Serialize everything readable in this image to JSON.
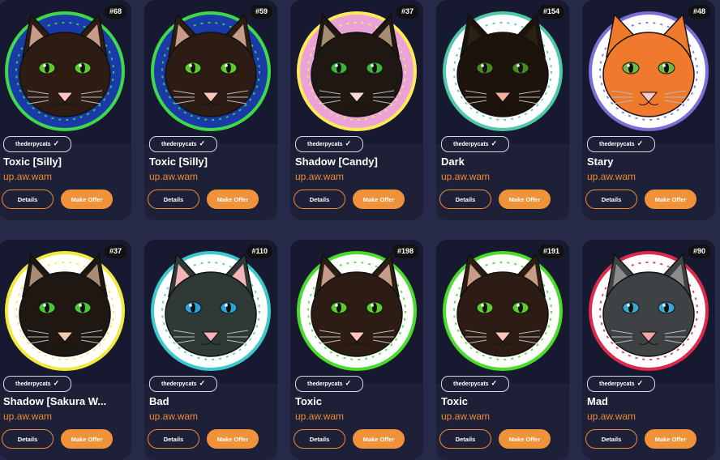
{
  "cards": [
    {
      "id": "#68",
      "creator": "thederpycats",
      "title": "Toxic [Silly]",
      "owner": "up.aw.wam",
      "details": "Details",
      "offer": "Make Offer",
      "ring": "#1a3aa8",
      "ring2": "#3fd84a",
      "face": "#2c1c14",
      "ear": "#c79c86",
      "eye": "#5ecb2a",
      "nose": "#ffc4b8",
      "frame": "#1a1c35"
    },
    {
      "id": "#59",
      "creator": "thederpycats",
      "title": "Toxic [Silly]",
      "owner": "up.aw.wam",
      "details": "Details",
      "offer": "Make Offer",
      "ring": "#1a3aa8",
      "ring2": "#3fd84a",
      "face": "#2c1c14",
      "ear": "#c79c86",
      "eye": "#5ecb2a",
      "nose": "#ffc4b8",
      "frame": "#1a1c35"
    },
    {
      "id": "#37",
      "creator": "thederpycats",
      "title": "Shadow [Candy]",
      "owner": "up.aw.wam",
      "details": "Details",
      "offer": "Make Offer",
      "ring": "#e9a3d6",
      "ring2": "#ffe95a",
      "face": "#1f1712",
      "ear": "#a88c70",
      "eye": "#3cb437",
      "nose": "#ffd8d0",
      "frame": "#1a1c35"
    },
    {
      "id": "#154",
      "creator": "thederpycats",
      "title": "Dark",
      "owner": "up.aw.wam",
      "details": "Details",
      "offer": "Make Offer",
      "ring": "#ffffff",
      "ring2": "#4ec8a6",
      "face": "#1c130d",
      "ear": "#2b2015",
      "eye": "#4a8a22",
      "nose": "#f5b09a",
      "frame": "#1a1c35"
    },
    {
      "id": "#48",
      "creator": "thederpycats",
      "title": "Stary",
      "owner": "up.aw.wam",
      "details": "Details",
      "offer": "Make Offer",
      "ring": "#ffffff",
      "ring2": "#7a6ed8",
      "face": "#ef7a2e",
      "ear": "#ef7a2e",
      "eye": "#6fb84a",
      "nose": "#ffc7c7",
      "frame": "#1a1c35"
    },
    {
      "id": "#37",
      "creator": "thederpycats",
      "title": "Shadow [Sakura W...",
      "owner": "up.aw.wam",
      "details": "Details",
      "offer": "Make Offer",
      "ring": "#ffffff",
      "ring2": "#f2ea3a",
      "face": "#1f1712",
      "ear": "#a88c70",
      "eye": "#4ec936",
      "nose": "#f5c8a8",
      "frame": "#1a1c35"
    },
    {
      "id": "#110",
      "creator": "thederpycats",
      "title": "Bad",
      "owner": "up.aw.wam",
      "details": "Details",
      "offer": "Make Offer",
      "ring": "#ffffff",
      "ring2": "#3cc8cc",
      "face": "#2f3a36",
      "ear": "#f4b4b8",
      "eye": "#2aa4d8",
      "nose": "#f4b4b8",
      "frame": "#1a1c35"
    },
    {
      "id": "#198",
      "creator": "thederpycats",
      "title": "Toxic",
      "owner": "up.aw.wam",
      "details": "Details",
      "offer": "Make Offer",
      "ring": "#ffffff",
      "ring2": "#4adc2a",
      "face": "#2c1c14",
      "ear": "#c79c86",
      "eye": "#5ecb2a",
      "nose": "#ffc4b8",
      "frame": "#1a1c35"
    },
    {
      "id": "#191",
      "creator": "thederpycats",
      "title": "Toxic",
      "owner": "up.aw.wam",
      "details": "Details",
      "offer": "Make Offer",
      "ring": "#ffffff",
      "ring2": "#4adc2a",
      "face": "#2c1c14",
      "ear": "#c79c86",
      "eye": "#5ecb2a",
      "nose": "#ffc4b8",
      "frame": "#1a1c35"
    },
    {
      "id": "#90",
      "creator": "thederpycats",
      "title": "Mad",
      "owner": "up.aw.wam",
      "details": "Details",
      "offer": "Make Offer",
      "ring": "#ffffff",
      "ring2": "#e0284a",
      "face": "#3e4244",
      "ear": "#8a8c8e",
      "eye": "#3aa6d0",
      "nose": "#f2a6a2",
      "frame": "#1a1c35"
    }
  ]
}
